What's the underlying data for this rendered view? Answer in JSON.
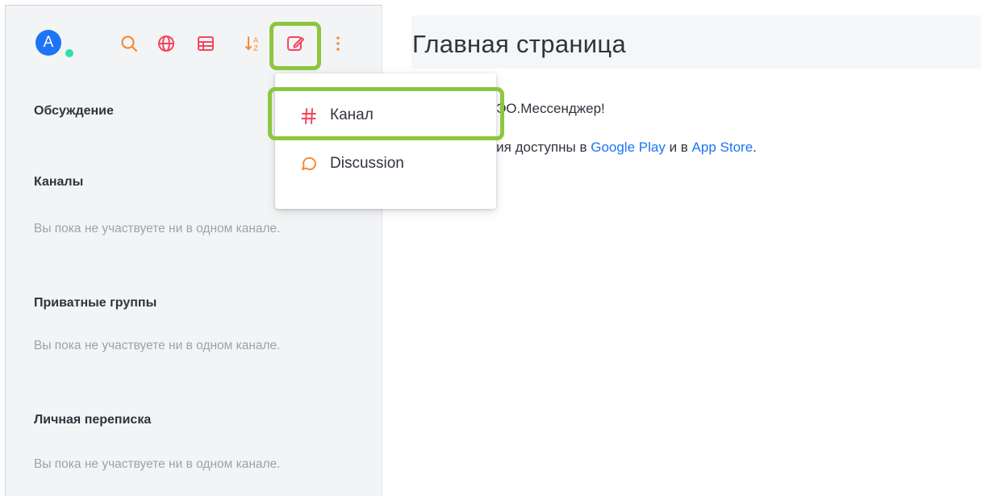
{
  "user": {
    "avatar_letter": "A",
    "status_color": "#2de0a5"
  },
  "toolbar": {
    "icons": [
      "search-icon",
      "directory-globe-icon",
      "display-table-icon",
      "sort-icon",
      "compose-pencil-icon",
      "kebab-menu-icon"
    ],
    "accent_color": "#f5455c"
  },
  "sidebar": {
    "sections": [
      {
        "title": "Обсуждение",
        "empty": ""
      },
      {
        "title": "Каналы",
        "empty": "Вы пока не участвуете ни в одном канале."
      },
      {
        "title": "Приватные группы",
        "empty": "Вы пока не участвуете ни в одном канале."
      },
      {
        "title": "Личная переписка",
        "empty": "Вы пока не участвуете ни в одном канале."
      }
    ]
  },
  "main": {
    "title": "Главная страница",
    "welcome": "каловать в МЭО.Мессенджер!",
    "apps_prefix": "ые приложения доступны в ",
    "google_play": "Google Play",
    "apps_middle": " и в ",
    "app_store": "App Store",
    "apps_suffix": "."
  },
  "create_menu": {
    "items": [
      {
        "label": "Канал",
        "icon": "hash-icon"
      },
      {
        "label": "Discussion",
        "icon": "discussion-icon"
      }
    ]
  },
  "colors": {
    "highlight": "#8dc63f",
    "link": "#1d74f5",
    "icon_orange": "#f5455c"
  }
}
